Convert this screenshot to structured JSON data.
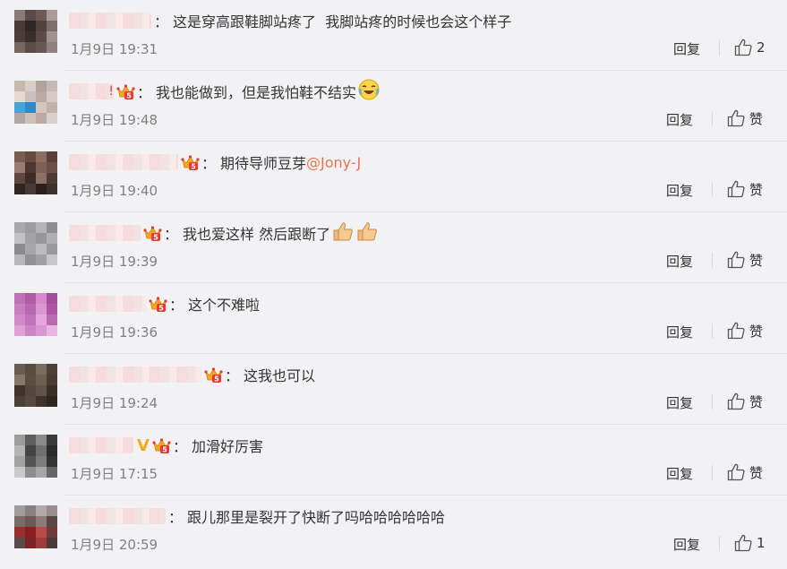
{
  "comments": [
    {
      "username_label": "",
      "avatar_colors": [
        "#8a7a78",
        "#5a4a4a",
        "#6d5a55",
        "#a99b98",
        "#4a3b3a",
        "#2e2624",
        "#54403c",
        "#7c6f6c",
        "#4b3d3b",
        "#3a2e2c",
        "#5c4a46",
        "#9f928f",
        "#76685f",
        "#5a4d48",
        "#665855",
        "#8d827f"
      ],
      "name_width": 92,
      "badges": [],
      "text": "这是穿高跟鞋脚站疼了  我脚站疼的时候也会这个样子",
      "mention": "",
      "emoji": [],
      "time": "1月9日 19:31",
      "reply_label": "回复",
      "like_label": "2",
      "colon": "："
    },
    {
      "username_label": "!",
      "avatar_colors": [
        "#c9b8ae",
        "#d8cfcb",
        "#b2a29b",
        "#c5b9b4",
        "#e5d9d4",
        "#cbbfbb",
        "#b9aaa3",
        "#d6cac6",
        "#47a3d8",
        "#2f8bc8",
        "#d3c6c1",
        "#c1b2ac",
        "#b4a7a2",
        "#cdc0bb",
        "#bba9a2",
        "#d9d0cc"
      ],
      "name_width": 50,
      "badges": [
        "crown"
      ],
      "text": "我也能做到，但是我怕鞋不结实",
      "mention": "",
      "emoji": [
        "laugh-cry"
      ],
      "time": "1月9日 19:48",
      "reply_label": "回复",
      "like_label": "赞",
      "colon": "："
    },
    {
      "username_label": "",
      "avatar_colors": [
        "#7a5c52",
        "#6b4a3f",
        "#8c6d62",
        "#5a4038",
        "#9a7b6f",
        "#4c3630",
        "#7e5f55",
        "#6a5048",
        "#5f4740",
        "#3e2b26",
        "#8b7067",
        "#4f3a33",
        "#302421",
        "#4a3a35",
        "#2a1f1c",
        "#3d2f2b"
      ],
      "name_width": 122,
      "badges": [
        "crown"
      ],
      "text": "期待导师豆芽",
      "mention": "@Jony-J",
      "emoji": [],
      "time": "1月9日 19:40",
      "reply_label": "回复",
      "like_label": "赞",
      "colon": "："
    },
    {
      "username_label": "",
      "avatar_colors": [
        "#a9a9ad",
        "#9c9ca0",
        "#b5b5b9",
        "#8e8e92",
        "#c2c2c6",
        "#a3a3a7",
        "#97979b",
        "#b0b0b4",
        "#8b8b8f",
        "#a7a7ab",
        "#bcbcc0",
        "#9a9a9e",
        "#b7b7bb",
        "#929296",
        "#a0a0a4",
        "#c6c6ca"
      ],
      "name_width": 80,
      "badges": [
        "crown"
      ],
      "text": "我也爱这样 然后跟断了",
      "mention": "",
      "emoji": [
        "thumbs-up",
        "thumbs-up"
      ],
      "time": "1月9日 19:39",
      "reply_label": "回复",
      "like_label": "赞",
      "colon": "："
    },
    {
      "username_label": "",
      "avatar_colors": [
        "#c070b8",
        "#b05aa8",
        "#d48acb",
        "#a44e9c",
        "#c97fc0",
        "#ba67b1",
        "#dc97d3",
        "#ad56a5",
        "#d28ac9",
        "#c174b9",
        "#e4a6dc",
        "#b86bb0",
        "#e0a0d8",
        "#cc85c4",
        "#d897d0",
        "#eab4e3"
      ],
      "name_width": 86,
      "badges": [
        "crown"
      ],
      "text": "这个不难啦",
      "mention": "",
      "emoji": [],
      "time": "1月9日 19:36",
      "reply_label": "回复",
      "like_label": "赞",
      "colon": "："
    },
    {
      "username_label": "",
      "avatar_colors": [
        "#6b5c50",
        "#5a4b40",
        "#7a6b5f",
        "#4e4036",
        "#867769",
        "#5c4d42",
        "#6e5f53",
        "#4a3c33",
        "#3f332b",
        "#54463c",
        "#62534a",
        "#3a2f28",
        "#4c3f36",
        "#584a41",
        "#3e332c",
        "#2f2621"
      ],
      "name_width": 148,
      "badges": [
        "crown"
      ],
      "text": "这我也可以",
      "mention": "",
      "emoji": [],
      "time": "1月9日 19:24",
      "reply_label": "回复",
      "like_label": "赞",
      "colon": "："
    },
    {
      "username_label": "",
      "avatar_colors": [
        "#9c9c9c",
        "#5e5e5e",
        "#8a8a8a",
        "#3a3a3a",
        "#b5b5b5",
        "#444444",
        "#6f6f6f",
        "#2b2b2b",
        "#a3a3a3",
        "#555555",
        "#7b7b7b",
        "#333333",
        "#c9c9c9",
        "#8e8e8e",
        "#a6a6a6",
        "#666666"
      ],
      "name_width": 72,
      "badges": [
        "v",
        "crown"
      ],
      "text": "加滑好厉害",
      "mention": "",
      "emoji": [],
      "time": "1月9日 17:15",
      "reply_label": "回复",
      "like_label": "赞",
      "colon": "："
    },
    {
      "username_label": "",
      "avatar_colors": [
        "#a39a9a",
        "#8c7f7f",
        "#b3a9a9",
        "#9a8d8d",
        "#7a6b6b",
        "#6b5858",
        "#8e7a7a",
        "#5a4646",
        "#9c2d2d",
        "#8a1f1f",
        "#b84a4a",
        "#6e3a3a",
        "#5a4a4a",
        "#7b2222",
        "#a33a3a",
        "#4a3a3a"
      ],
      "name_width": 108,
      "badges": [],
      "text": "跟儿那里是裂开了快断了吗哈哈哈哈哈哈",
      "mention": "",
      "emoji": [],
      "time": "1月9日 20:59",
      "reply_label": "回复",
      "like_label": "1",
      "colon": "："
    }
  ]
}
